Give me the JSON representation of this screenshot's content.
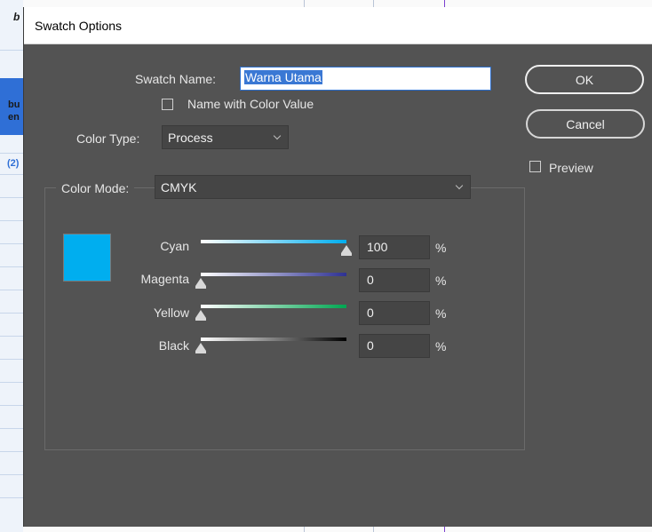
{
  "background": {
    "fragments": [
      "b",
      "bu",
      "en",
      "(2)"
    ]
  },
  "dialog": {
    "title": "Swatch Options",
    "swatch_name_label": "Swatch Name:",
    "swatch_name_value": "Warna Utama",
    "name_with_color_value_label": "Name with Color Value",
    "color_type_label": "Color Type:",
    "color_type_value": "Process",
    "color_mode_label": "Color Mode:",
    "color_mode_value": "CMYK",
    "ok_label": "OK",
    "cancel_label": "Cancel",
    "preview_label": "Preview",
    "percent_symbol": "%",
    "swatch_color": "#00aeef",
    "sliders": [
      {
        "label": "Cyan",
        "value": "100",
        "fraction": 1.0,
        "gradient_end": "#00aeef"
      },
      {
        "label": "Magenta",
        "value": "0",
        "fraction": 0.0,
        "gradient_end": "#2e3192"
      },
      {
        "label": "Yellow",
        "value": "0",
        "fraction": 0.0,
        "gradient_end": "#00a651"
      },
      {
        "label": "Black",
        "value": "0",
        "fraction": 0.0,
        "gradient_end": "#000000"
      }
    ]
  }
}
